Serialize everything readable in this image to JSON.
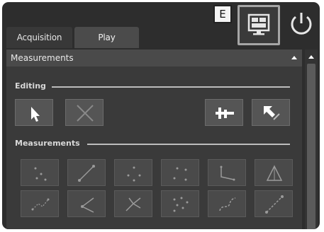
{
  "callout": {
    "label": "E"
  },
  "tabs": [
    {
      "label": "Acquisition"
    },
    {
      "label": "Play"
    }
  ],
  "panel": {
    "title": "Measurements",
    "sections": {
      "editing": "Editing",
      "measurements": "Measurements"
    }
  },
  "icons": {
    "display": "display-layout-icon",
    "power": "power-icon",
    "select": "pointer-icon",
    "delete": "delete-x-icon",
    "calibrate": "caliper-icon",
    "edit": "pen-arrow-icon"
  },
  "colors": {
    "background": "#2d2d2d",
    "panel": "#3a3a3a",
    "header": "#4a4a4a",
    "button": "#555555",
    "highlight_border": "#a6a6a6"
  }
}
